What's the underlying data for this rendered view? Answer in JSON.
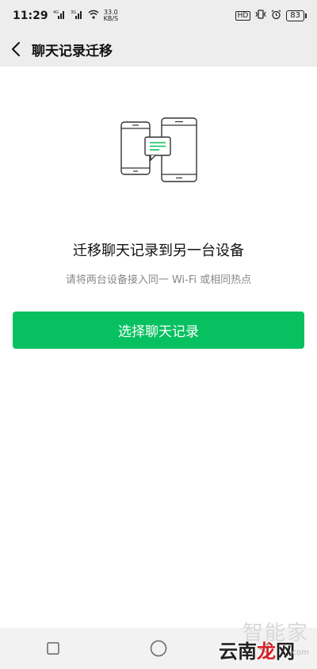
{
  "status_bar": {
    "time": "11:29",
    "signal1_label": "4G",
    "signal2_label": "3G",
    "net_speed_value": "33.0",
    "net_speed_unit": "KB/S",
    "hd_label": "HD",
    "battery": "83"
  },
  "header": {
    "title": "聊天记录迁移"
  },
  "main": {
    "title": "迁移聊天记录到另一台设备",
    "subtitle": "请将两台设备接入同一 Wi-Fi 或相同热点",
    "button_label": "选择聊天记录"
  },
  "watermark": {
    "top_text": "智能家",
    "bottom_prefix": "云南",
    "bottom_middle": "龙",
    "bottom_suffix": "网",
    "com": ".com"
  },
  "colors": {
    "accent": "#07c160",
    "header_bg": "#ededed"
  }
}
